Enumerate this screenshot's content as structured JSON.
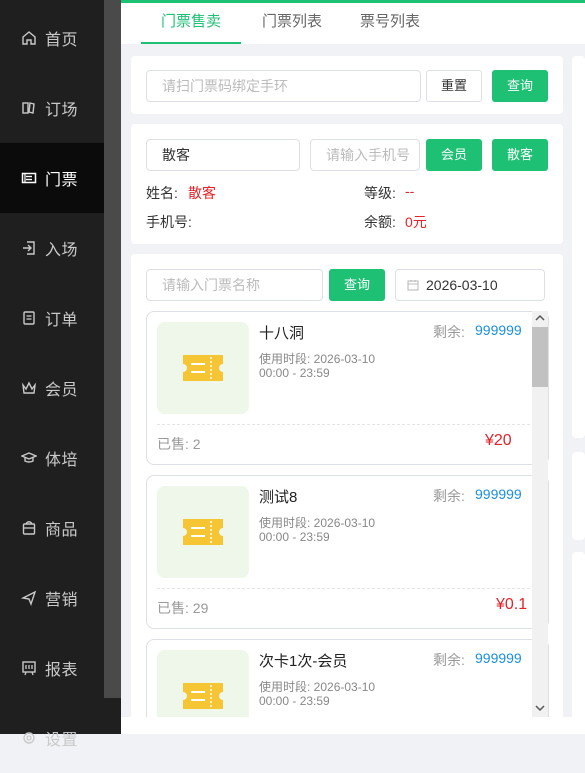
{
  "sidebar": {
    "items": [
      {
        "label": "首页",
        "icon": "home-icon"
      },
      {
        "label": "订场",
        "icon": "book-icon"
      },
      {
        "label": "门票",
        "icon": "ticket-icon",
        "active": true
      },
      {
        "label": "入场",
        "icon": "enter-icon"
      },
      {
        "label": "订单",
        "icon": "order-icon"
      },
      {
        "label": "会员",
        "icon": "crown-icon"
      },
      {
        "label": "体培",
        "icon": "graduation-icon"
      },
      {
        "label": "商品",
        "icon": "goods-icon"
      },
      {
        "label": "营销",
        "icon": "send-icon"
      },
      {
        "label": "报表",
        "icon": "report-icon"
      },
      {
        "label": "设置",
        "icon": "settings-icon"
      }
    ]
  },
  "tabs": [
    {
      "label": "门票售卖",
      "active": true
    },
    {
      "label": "门票列表"
    },
    {
      "label": "票号列表"
    }
  ],
  "scan": {
    "placeholder": "请扫门票码绑定手环",
    "reset_label": "重置",
    "query_label": "查询"
  },
  "customer": {
    "type_value": "散客",
    "phone_placeholder": "请输入手机号",
    "member_button": "会员",
    "walkin_button": "散客",
    "name_label": "姓名:",
    "name_value": "散客",
    "level_label": "等级:",
    "level_value": "--",
    "phone_label": "手机号:",
    "balance_label": "余额:",
    "balance_value": "0元"
  },
  "ticket_search": {
    "placeholder": "请输入门票名称",
    "query_label": "查询",
    "date": "2026-03-10"
  },
  "tickets": [
    {
      "name": "十八洞",
      "remain_label": "剩余:",
      "remain": "999999",
      "period": "使用时段: 2026-03-10",
      "time": "00:00 - 23:59",
      "sold": "已售: 2",
      "price": "¥20"
    },
    {
      "name": "测试8",
      "remain_label": "剩余:",
      "remain": "999999",
      "period": "使用时段: 2026-03-10",
      "time": "00:00 - 23:59",
      "sold": "已售: 29",
      "price": "¥0.1"
    },
    {
      "name": "次卡1次-会员",
      "remain_label": "剩余:",
      "remain": "999999",
      "period": "使用时段: 2026-03-10",
      "time": "00:00 - 23:59",
      "sold": "",
      "price": ""
    }
  ],
  "colors": {
    "accent": "#1ec174",
    "sidebar": "#1f1f1f",
    "price": "#e0242a",
    "remain": "#1a8fe0"
  }
}
